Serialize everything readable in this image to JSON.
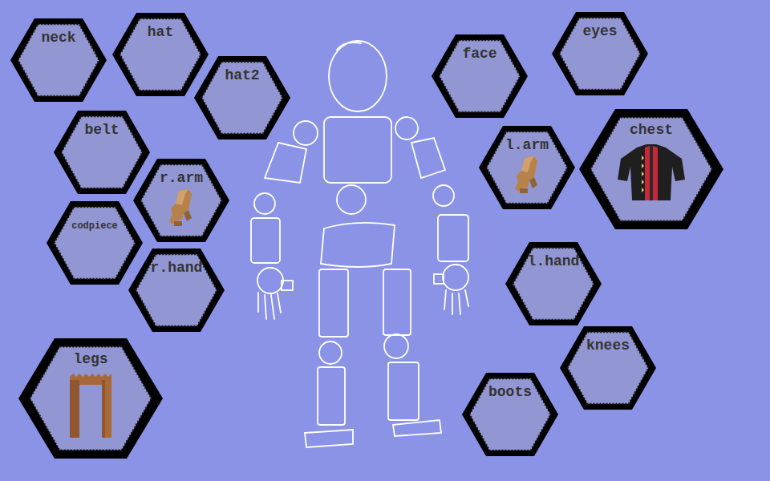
{
  "slots": [
    {
      "label": "neck",
      "kind": "empty"
    },
    {
      "label": "hat",
      "kind": "empty"
    },
    {
      "label": "hat2",
      "kind": "empty"
    },
    {
      "label": "belt",
      "kind": "empty"
    },
    {
      "label": "r.arm",
      "kind": "arm"
    },
    {
      "label": "codpiece",
      "kind": "empty"
    },
    {
      "label": "r.hand",
      "kind": "empty"
    },
    {
      "label": "legs",
      "kind": "legs"
    },
    {
      "label": "face",
      "kind": "empty"
    },
    {
      "label": "eyes",
      "kind": "empty"
    },
    {
      "label": "l.arm",
      "kind": "arm"
    },
    {
      "label": "chest",
      "kind": "chest"
    },
    {
      "label": "l.hand",
      "kind": "empty"
    },
    {
      "label": "knees",
      "kind": "empty"
    },
    {
      "label": "boots",
      "kind": "empty"
    }
  ]
}
